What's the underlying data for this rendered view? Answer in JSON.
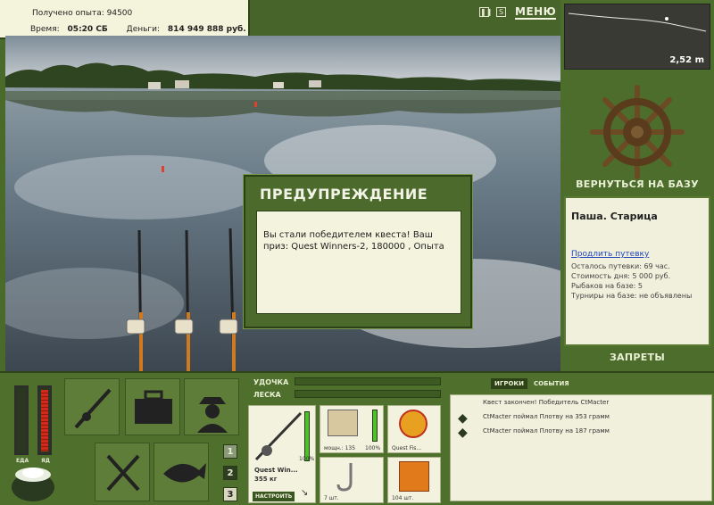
{
  "stats": {
    "exp_label": "Получено опыта:",
    "exp_value": "94500",
    "time_label": "Время:",
    "time_value": "05:20 СБ",
    "money_label": "Деньги:",
    "money_value": "814 949 888 руб."
  },
  "topbar": {
    "pause_icon": "pause-icon",
    "sound_icon": "sound-icon",
    "menu_label": "МЕНЮ"
  },
  "depth": {
    "value": "2,52 m"
  },
  "right_panel": {
    "return_label": "ВЕРНУТЬСЯ НА БАЗУ",
    "location_title": "Паша. Старица",
    "extend_link": "Продлить путевку",
    "lines": [
      "Осталось путевки: 69 час.",
      "Стоимость дня: 5 000 руб.",
      "Рыбаков на базе: 5",
      "Турниры на базе: не объявлены"
    ],
    "bans_label": "ЗАПРЕТЫ"
  },
  "meters": {
    "food_label": "ЕДА",
    "poison_label": "ЯД",
    "food_fill": 0.0,
    "poison_fill": 0.98
  },
  "inventory": {
    "pages": [
      "1",
      "2",
      "3"
    ]
  },
  "tackle": {
    "rod_label": "УДОЧКА",
    "line_label": "ЛЕСКА",
    "rod_name": "Quest Win...",
    "rod_weight": "355 кг",
    "rod_percent": "100%",
    "setup_button": "НАСТРОИТЬ",
    "reel_label": "мощн.: 135",
    "reel_percent": "100%",
    "line_name": "Quest Fis...",
    "hook_count": "7 шт.",
    "bait_count": "104 шт."
  },
  "chat": {
    "tab_players": "ИГРОКИ",
    "tab_events": "СОБЫТИЯ",
    "messages": [
      "Квест закончен! Победитель CtMacter",
      "CtMacter поймал Плотву на 353 грамм",
      "CtMacter поймал Плотву на 187 грамм"
    ]
  },
  "dialog": {
    "title": "ПРЕДУПРЕЖДЕНИЕ",
    "message": "Вы стали победителем квеста! Ваш приз: Quest Winners-2, 180000 , Опыта"
  },
  "colors": {
    "panel_green": "#4d6d2c",
    "cream": "#f0f0dc",
    "link_blue": "#2244bb"
  }
}
